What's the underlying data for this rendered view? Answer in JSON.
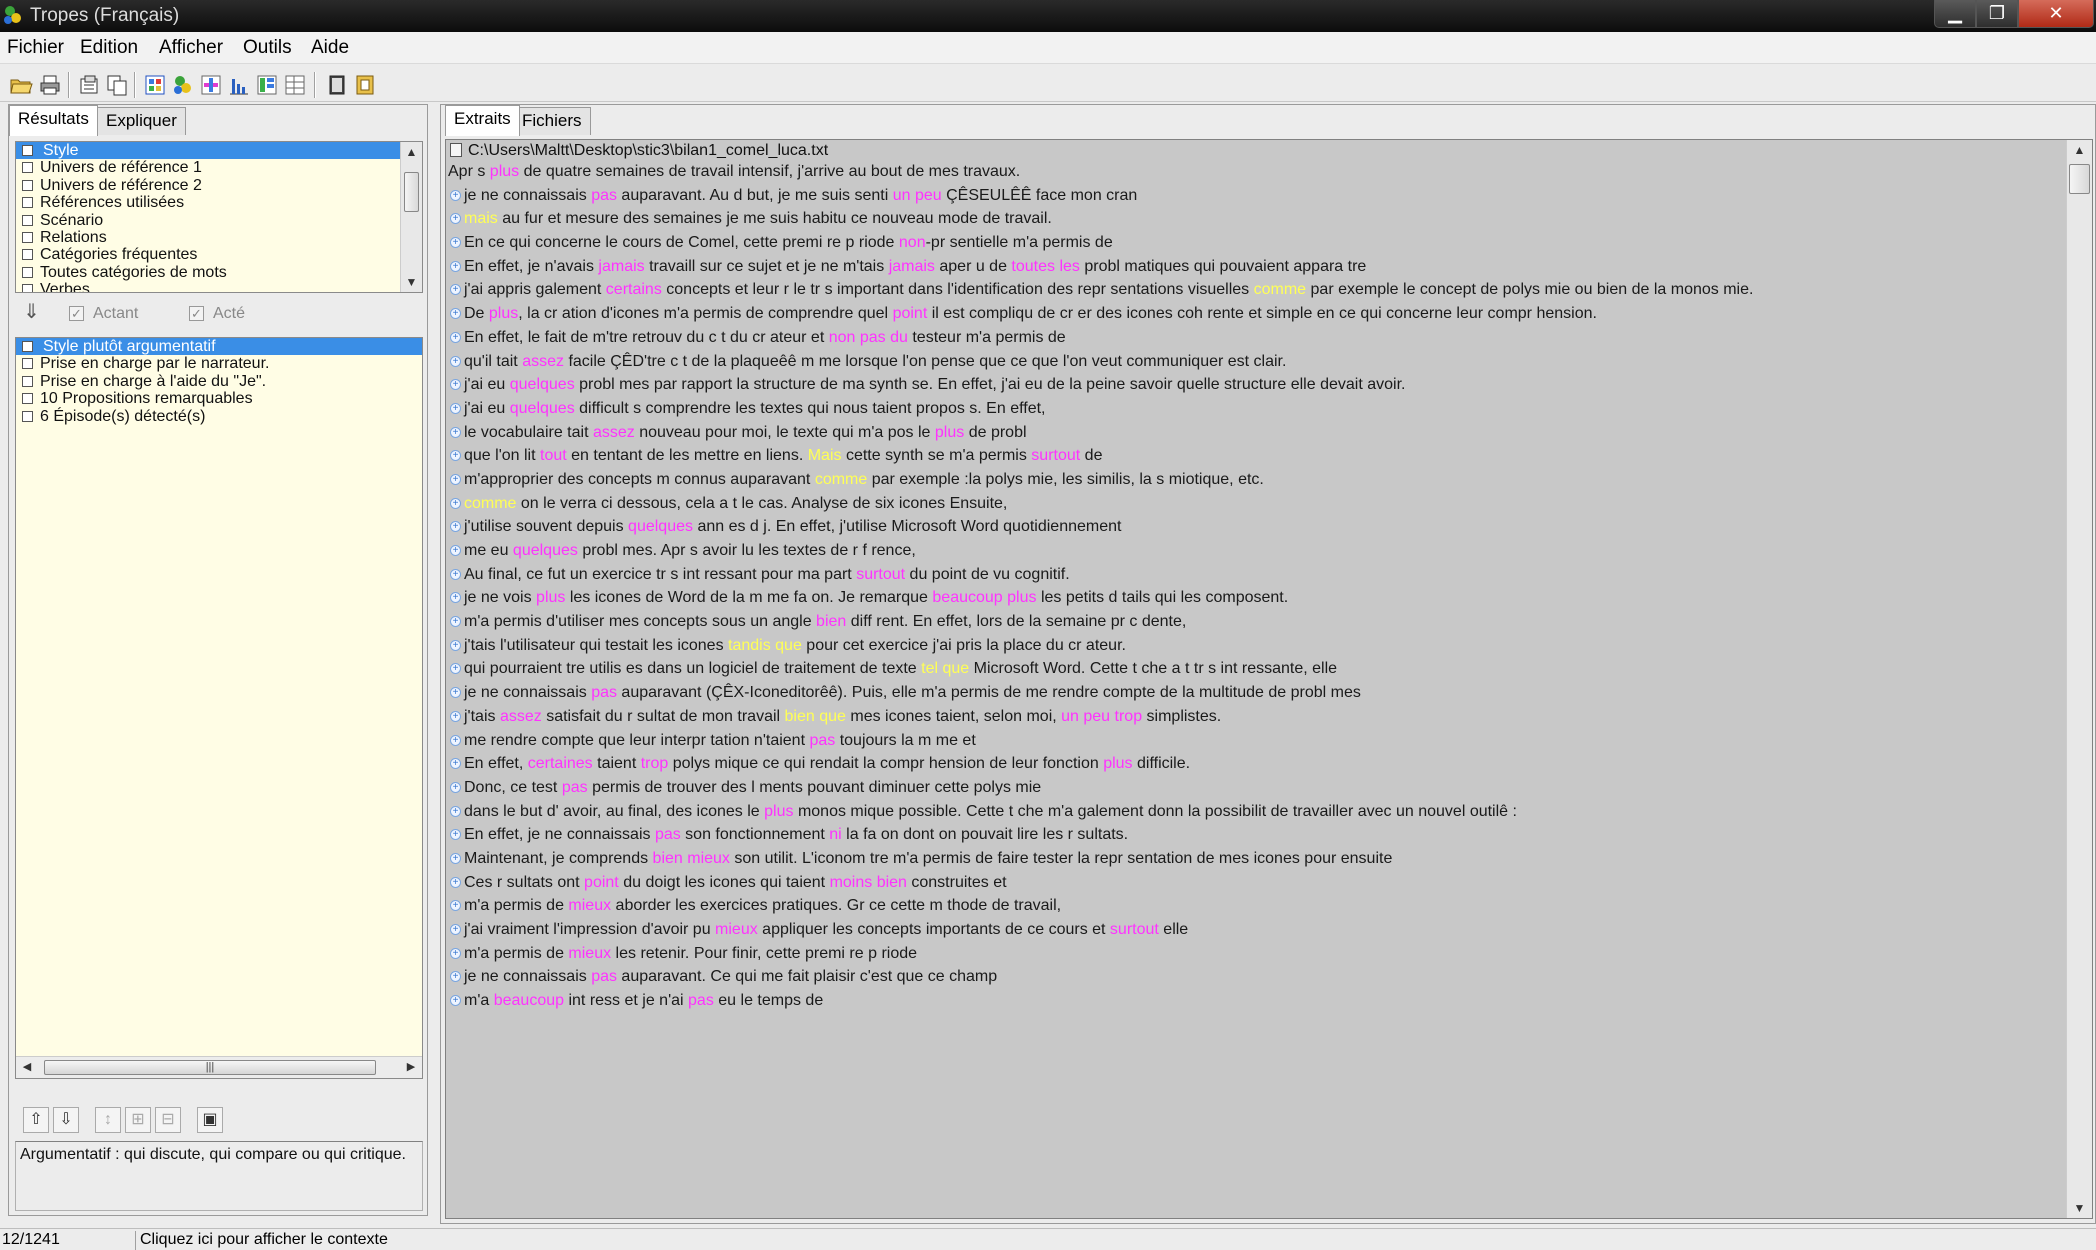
{
  "window": {
    "title": "Tropes (Français)",
    "min_glyph": "▁",
    "max_glyph": "❐",
    "close_glyph": "✕"
  },
  "menu": [
    "Fichier",
    "Edition",
    "Afficher",
    "Outils",
    "Aide"
  ],
  "left_tabs": [
    "Résultats",
    "Expliquer"
  ],
  "results_list": [
    {
      "label": "Style",
      "selected": true
    },
    {
      "label": "Univers de référence 1"
    },
    {
      "label": "Univers de référence 2"
    },
    {
      "label": "Références utilisées"
    },
    {
      "label": "Scénario"
    },
    {
      "label": "Relations"
    },
    {
      "label": "Catégories fréquentes"
    },
    {
      "label": "Toutes catégories de mots"
    },
    {
      "label": "Verbes"
    }
  ],
  "filters": {
    "actant": "Actant",
    "acte": "Acté"
  },
  "style_list": [
    {
      "label": "Style plutôt argumentatif",
      "selected": true
    },
    {
      "label": "Prise en charge par le narrateur."
    },
    {
      "label": "Prise en charge à l'aide du \"Je\"."
    },
    {
      "label": "10 Propositions remarquables"
    },
    {
      "label": "6 Épisode(s) détecté(s)"
    }
  ],
  "explanation": "Argumentatif : qui discute, qui compare ou qui critique.",
  "right_tabs": [
    "Extraits",
    "Fichiers"
  ],
  "file_path": "C:\\Users\\Maltt\\Desktop\\stic3\\bilan1_comel_luca.txt",
  "lines": [
    {
      "bullet": false,
      "segs": [
        [
          "Apr s ",
          ""
        ],
        [
          "plus",
          "m"
        ],
        [
          " de quatre semaines de travail intensif,  j'arrive au bout de mes travaux.",
          ""
        ]
      ]
    },
    {
      "segs": [
        [
          "je ne connaissais ",
          ""
        ],
        [
          "pas",
          "m"
        ],
        [
          " auparavant. Au d but,  je me suis senti ",
          ""
        ],
        [
          "un peu",
          "m"
        ],
        [
          " ÇÊSEULÊÊ face mon cran",
          ""
        ]
      ]
    },
    {
      "segs": [
        [
          "mais",
          "y"
        ],
        [
          " au fur et mesure des semaines je  me suis habitu ce nouveau mode de travail.",
          ""
        ]
      ]
    },
    {
      "segs": [
        [
          "En ce qui concerne le cours de Comel, cette premi re p riode ",
          ""
        ],
        [
          "non",
          "m"
        ],
        [
          "-pr sentielle m'a permis de",
          ""
        ]
      ]
    },
    {
      "segs": [
        [
          "En effet, je n'avais ",
          ""
        ],
        [
          "jamais",
          "m"
        ],
        [
          " travaill sur ce sujet et je ne  m'tais ",
          ""
        ],
        [
          "jamais",
          "m"
        ],
        [
          " aper u de ",
          ""
        ],
        [
          "toutes les",
          "m"
        ],
        [
          " probl matiques qui pouvaient appara tre",
          ""
        ]
      ]
    },
    {
      "segs": [
        [
          "j'ai appris galement ",
          ""
        ],
        [
          "certains",
          "m"
        ],
        [
          " concepts  et leur r le tr s important dans l'identification des repr sentations visuelles ",
          ""
        ],
        [
          "comme",
          "y"
        ],
        [
          " par exemple le concept de polys mie ou bien de la monos mie.",
          ""
        ]
      ]
    },
    {
      "segs": [
        [
          "De ",
          ""
        ],
        [
          "plus",
          "m"
        ],
        [
          ", la cr ation d'icones m'a permis de comprendre quel ",
          ""
        ],
        [
          "point",
          "m"
        ],
        [
          " il est compliqu de cr er des icones coh rente et simple en ce qui concerne leur compr hension.",
          ""
        ]
      ]
    },
    {
      "segs": [
        [
          "En effet, le fait de m'tre retrouv du c t du cr ateur et ",
          ""
        ],
        [
          "non pas du",
          "m"
        ],
        [
          " testeur m'a permis de",
          ""
        ]
      ]
    },
    {
      "segs": [
        [
          "qu'il tait ",
          ""
        ],
        [
          "assez",
          "m"
        ],
        [
          " facile ÇÊD'tre c t de la plaqueêê m me  lorsque l'on pense que ce que l'on veut communiquer est clair.",
          ""
        ]
      ]
    },
    {
      "segs": [
        [
          "j'ai eu ",
          ""
        ],
        [
          "quelques",
          "m"
        ],
        [
          " probl mes par rapport la structure de ma synth se. En effet, j'ai eu de la peine savoir quelle structure elle devait avoir.",
          ""
        ]
      ]
    },
    {
      "segs": [
        [
          "j'ai eu ",
          ""
        ],
        [
          "quelques",
          "m"
        ],
        [
          " difficult s comprendre les textes qui nous taient propos s. En effet,",
          ""
        ]
      ]
    },
    {
      "segs": [
        [
          "le vocabulaire tait ",
          ""
        ],
        [
          "assez",
          "m"
        ],
        [
          " nouveau pour moi,  le texte qui m'a pos le ",
          ""
        ],
        [
          "plus",
          "m"
        ],
        [
          " de probl",
          ""
        ]
      ]
    },
    {
      "segs": [
        [
          "que l'on lit ",
          ""
        ],
        [
          "tout",
          "m"
        ],
        [
          "  en tentant de les mettre en liens. ",
          ""
        ],
        [
          "Mais",
          "y"
        ],
        [
          " cette synth se m'a permis ",
          ""
        ],
        [
          "surtout",
          "m"
        ],
        [
          " de",
          ""
        ]
      ]
    },
    {
      "segs": [
        [
          "m'approprier des concepts m connus auparavant ",
          ""
        ],
        [
          "comme",
          "y"
        ],
        [
          " par exemple :la polys mie, les similis, la s miotique, etc.",
          ""
        ]
      ]
    },
    {
      "segs": [
        [
          "comme",
          "y"
        ],
        [
          " on le verra ci dessous,  cela a t le cas. Analyse de six icones Ensuite,",
          ""
        ]
      ]
    },
    {
      "segs": [
        [
          "j'utilise souvent depuis ",
          ""
        ],
        [
          "quelques",
          "m"
        ],
        [
          " ann es d j. En effet,  j'utilise Microsoft Word quotidiennement",
          ""
        ]
      ]
    },
    {
      "segs": [
        [
          "me eu ",
          ""
        ],
        [
          "quelques",
          "m"
        ],
        [
          " probl mes. Apr s avoir lu les textes de r f rence,",
          ""
        ]
      ]
    },
    {
      "segs": [
        [
          "Au final, ce fut un exercice tr s int ressant pour ma part ",
          ""
        ],
        [
          "surtout",
          "m"
        ],
        [
          " du point de vu cognitif.",
          ""
        ]
      ]
    },
    {
      "segs": [
        [
          "je ne vois ",
          ""
        ],
        [
          "plus",
          "m"
        ],
        [
          " les icones de Word de la m me fa on. Je remarque ",
          ""
        ],
        [
          "beaucoup plus",
          "m"
        ],
        [
          " les petits d tails qui les composent.",
          ""
        ]
      ]
    },
    {
      "segs": [
        [
          "m'a permis d'utiliser mes concepts sous un angle ",
          ""
        ],
        [
          "bien",
          "m"
        ],
        [
          " diff rent. En effet, lors de la semaine pr c dente,",
          ""
        ]
      ]
    },
    {
      "segs": [
        [
          "j'tais l'utilisateur qui testait les icones ",
          ""
        ],
        [
          "tandis que",
          "y"
        ],
        [
          " pour cet exercice  j'ai pris la place du cr ateur.",
          ""
        ]
      ]
    },
    {
      "segs": [
        [
          "qui pourraient tre utilis es dans un logiciel de traitement de texte ",
          ""
        ],
        [
          "tel que",
          "y"
        ],
        [
          " Microsoft Word. Cette t che a t tr s int ressante, elle",
          ""
        ]
      ]
    },
    {
      "segs": [
        [
          "je ne connaissais ",
          ""
        ],
        [
          "pas",
          "m"
        ],
        [
          " auparavant (ÇÊX-Iconeditorêê). Puis, elle m'a permis de  me rendre compte de la multitude de probl mes",
          ""
        ]
      ]
    },
    {
      "segs": [
        [
          "j'tais ",
          ""
        ],
        [
          "assez",
          "m"
        ],
        [
          " satisfait du r sultat de mon travail ",
          ""
        ],
        [
          "bien que",
          "y"
        ],
        [
          " mes icones taient, selon moi, ",
          ""
        ],
        [
          "un peu trop",
          "m"
        ],
        [
          " simplistes.",
          ""
        ]
      ]
    },
    {
      "segs": [
        [
          "me rendre compte que leur interpr tation n'taient ",
          ""
        ],
        [
          "pas",
          "m"
        ],
        [
          " toujours la m me et",
          ""
        ]
      ]
    },
    {
      "segs": [
        [
          "En effet, ",
          ""
        ],
        [
          "certaines",
          "m"
        ],
        [
          " taient ",
          ""
        ],
        [
          "trop",
          "m"
        ],
        [
          " polys mique ce qui rendait la compr hension de leur fonction ",
          ""
        ],
        [
          "plus",
          "m"
        ],
        [
          " difficile.",
          ""
        ]
      ]
    },
    {
      "segs": [
        [
          "Donc, ce test ",
          ""
        ],
        [
          "pas",
          "m"
        ],
        [
          " permis de trouver des l ments pouvant diminuer cette polys mie",
          ""
        ]
      ]
    },
    {
      "segs": [
        [
          "dans le but d' avoir, au final, des icones le ",
          ""
        ],
        [
          "plus",
          "m"
        ],
        [
          " monos mique possible. Cette t che m'a galement donn la possibilit de travailler avec un nouvel outilê :",
          ""
        ]
      ]
    },
    {
      "segs": [
        [
          "En effet, je ne connaissais ",
          ""
        ],
        [
          "pas",
          "m"
        ],
        [
          " son fonctionnement ",
          ""
        ],
        [
          "ni",
          "m"
        ],
        [
          " la fa on dont on pouvait lire les r sultats.",
          ""
        ]
      ]
    },
    {
      "segs": [
        [
          "Maintenant, je comprends ",
          ""
        ],
        [
          "bien mieux",
          "m"
        ],
        [
          " son utilit. L'iconom tre m'a permis de faire tester la repr sentation de mes icones pour ensuite",
          ""
        ]
      ]
    },
    {
      "segs": [
        [
          "Ces r sultats ont ",
          ""
        ],
        [
          "point",
          "m"
        ],
        [
          " du doigt les icones  qui taient ",
          ""
        ],
        [
          "moins bien",
          "m"
        ],
        [
          " construites et",
          ""
        ]
      ]
    },
    {
      "segs": [
        [
          "m'a permis de ",
          ""
        ],
        [
          "mieux",
          "m"
        ],
        [
          " aborder les exercices pratiques. Gr ce cette m thode de travail,",
          ""
        ]
      ]
    },
    {
      "segs": [
        [
          "j'ai vraiment l'impression d'avoir pu ",
          ""
        ],
        [
          "mieux",
          "m"
        ],
        [
          " appliquer les concepts importants de ce cours et ",
          ""
        ],
        [
          "surtout",
          "m"
        ],
        [
          " elle",
          ""
        ]
      ]
    },
    {
      "segs": [
        [
          "m'a permis de ",
          ""
        ],
        [
          "mieux",
          "m"
        ],
        [
          " les retenir. Pour finir, cette premi re p riode",
          ""
        ]
      ]
    },
    {
      "segs": [
        [
          "je ne connaissais ",
          ""
        ],
        [
          "pas",
          "m"
        ],
        [
          " auparavant. Ce qui me fait plaisir c'est que ce champ",
          ""
        ]
      ]
    },
    {
      "segs": [
        [
          "m'a ",
          ""
        ],
        [
          "beaucoup",
          "m"
        ],
        [
          " int ress et  je n'ai ",
          ""
        ],
        [
          "pas",
          "m"
        ],
        [
          " eu le temps de",
          ""
        ]
      ]
    }
  ],
  "status": {
    "position": "12/1241",
    "hint": "Cliquez ici pour afficher le contexte"
  },
  "colors": {
    "selection": "#3a8ee6",
    "adverb_highlight": "#ff33ff",
    "connector_highlight": "#ffff55",
    "list_background": "#fffde5",
    "text_background": "#c8c8c8"
  }
}
